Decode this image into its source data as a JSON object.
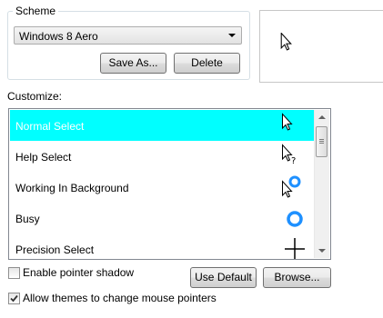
{
  "scheme": {
    "group_label": "Scheme",
    "selected": "Windows 8 Aero",
    "save_as_label": "Save As...",
    "delete_label": "Delete"
  },
  "customize": {
    "label": "Customize:",
    "items": [
      {
        "label": "Normal Select",
        "icon": "arrow-cursor-icon",
        "selected": true
      },
      {
        "label": "Help Select",
        "icon": "help-cursor-icon",
        "selected": false
      },
      {
        "label": "Working In Background",
        "icon": "working-cursor-icon",
        "selected": false
      },
      {
        "label": "Busy",
        "icon": "busy-cursor-icon",
        "selected": false
      },
      {
        "label": "Precision Select",
        "icon": "crosshair-cursor-icon",
        "selected": false
      }
    ]
  },
  "options": {
    "pointer_shadow_label": "Enable pointer shadow",
    "pointer_shadow_checked": false,
    "allow_themes_label": "Allow themes to change mouse pointers",
    "allow_themes_checked": true
  },
  "buttons": {
    "use_default_label": "Use Default",
    "browse_label": "Browse..."
  },
  "colors": {
    "selection": "#00ffff",
    "busy_ring": "#1e90ff"
  }
}
